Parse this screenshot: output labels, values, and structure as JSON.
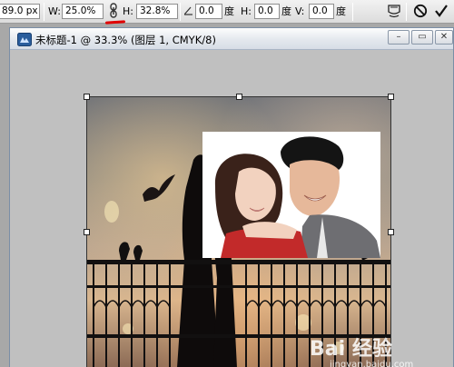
{
  "options_bar": {
    "x_value": "89.0 px",
    "w_label": "W:",
    "w_value": "25.0%",
    "h_label": "H:",
    "h_value": "32.8%",
    "angle_value": "0.0",
    "angle_unit": "度",
    "hskew_label": "H:",
    "hskew_value": "0.0",
    "hskew_unit": "度",
    "vskew_label": "V:",
    "vskew_value": "0.0",
    "vskew_unit": "度",
    "icons": [
      "link-icon",
      "angle-icon",
      "warp-icon",
      "cancel-icon",
      "commit-icon"
    ]
  },
  "document": {
    "title": "未标题-1 @ 33.3% (图层 1, CMYK/8)",
    "minimize": "–",
    "restore": "▭",
    "close": "✕"
  },
  "watermark": {
    "brand": "Bai 经验",
    "url": "jingyan.baidu.com"
  },
  "colors": {
    "highlight_underline": "#e00000",
    "titlebar": "#e4e8ee",
    "workspace": "#c0c0c0"
  }
}
